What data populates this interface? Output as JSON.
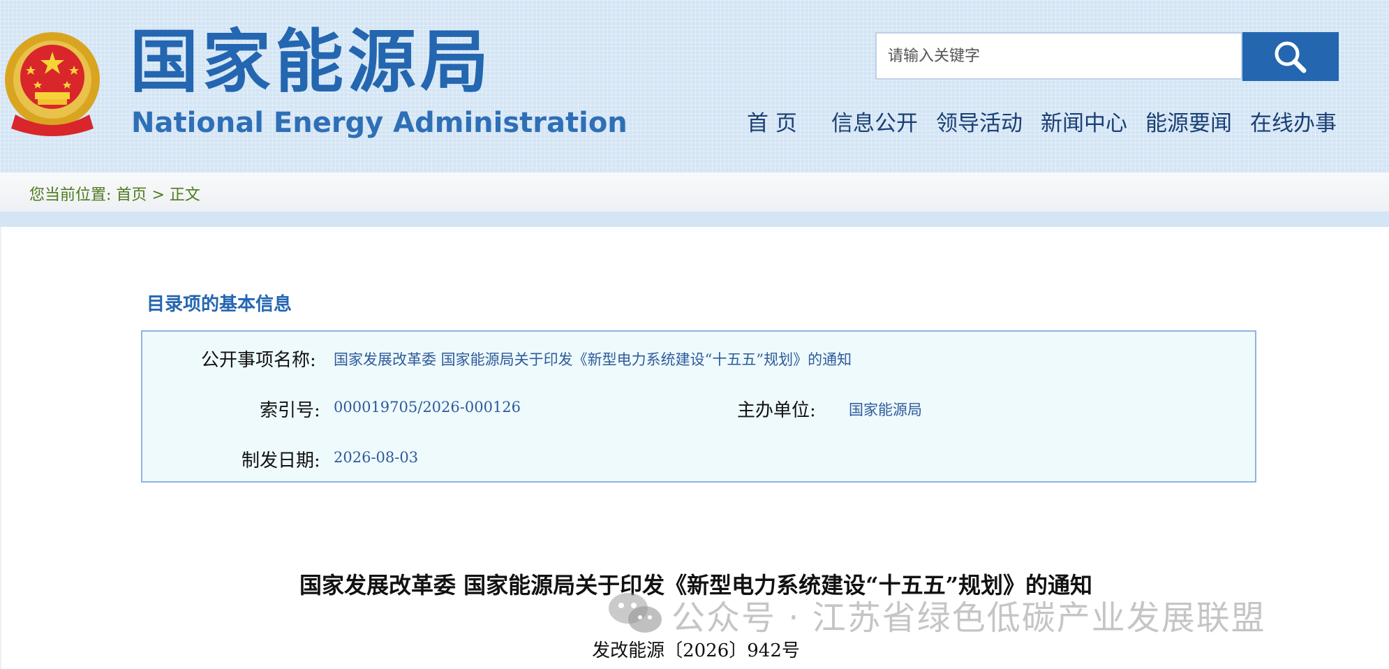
{
  "header": {
    "title_cn": "国家能源局",
    "title_en": "National Energy Administration",
    "search": {
      "placeholder": "请输入关键字"
    },
    "nav": [
      "首 页",
      "信息公开",
      "领导活动",
      "新闻中心",
      "能源要闻",
      "在线办事"
    ]
  },
  "breadcrumb": {
    "prefix": "您当前位置:",
    "home": "首页",
    "separator": ">",
    "current": "正文"
  },
  "catalog": {
    "section_title": "目录项的基本信息",
    "name_label": "公开事项名称:",
    "name_value": "国家发展改革委 国家能源局关于印发《新型电力系统建设“十五五”规划》的通知",
    "index_label": "索引号:",
    "index_value": "000019705/2026-000126",
    "host_label": "主办单位:",
    "host_value": "国家能源局",
    "date_label": "制发日期:",
    "date_value": "2026-08-03"
  },
  "document": {
    "title": "国家发展改革委 国家能源局关于印发《新型电力系统建设“十五五”规划》的通知",
    "number": "发改能源〔2026〕942号"
  },
  "watermark": {
    "text": "公众号 · 江苏省绿色低碳产业发展联盟",
    "icon": "wechat-icon"
  },
  "colors": {
    "brand_blue": "#2466b0",
    "header_bg": "#d4e5f5",
    "breadcrumb_green": "#4e7a1c",
    "info_box_bg": "#eefafc",
    "info_box_border": "#8fb3e0"
  }
}
